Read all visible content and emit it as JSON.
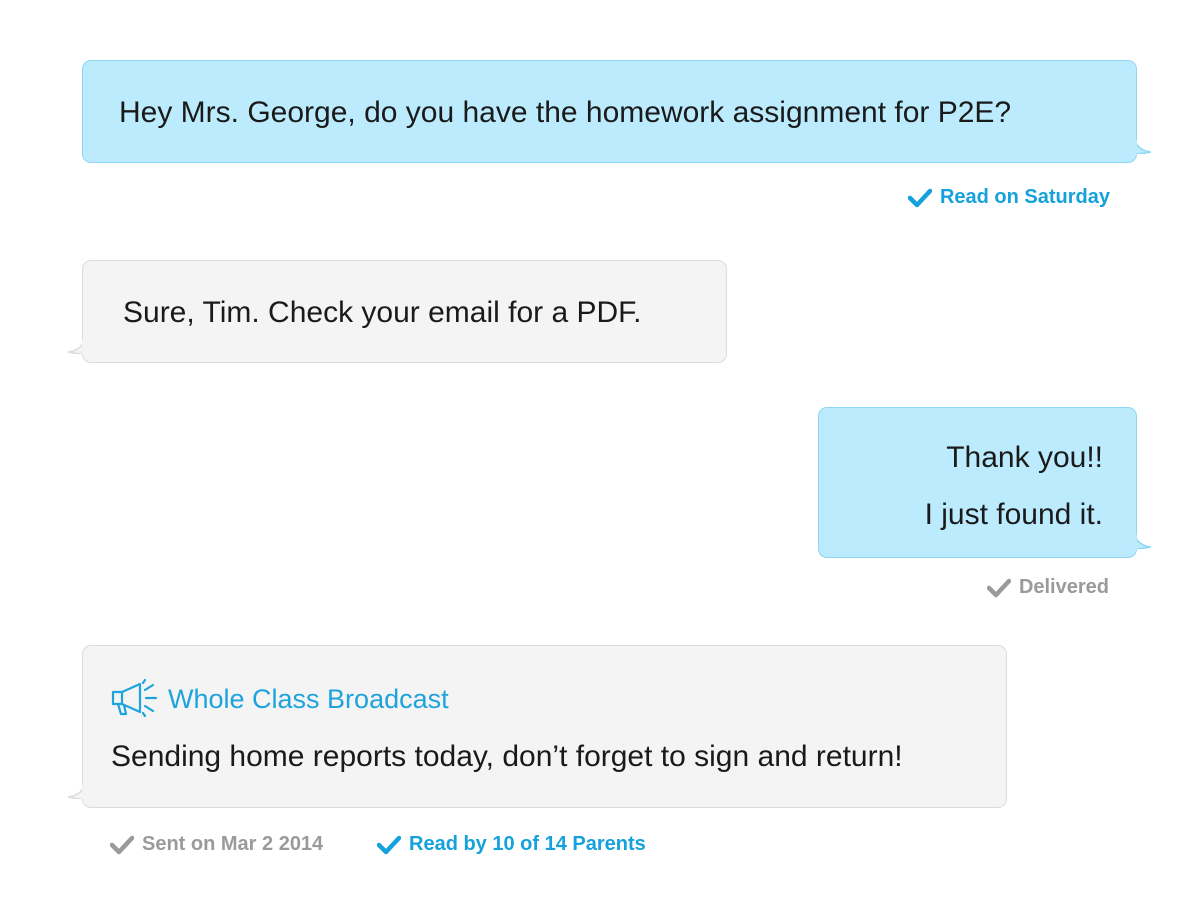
{
  "colors": {
    "outgoing_bubble": "#bbebfd",
    "incoming_bubble": "#f4f4f4",
    "accent_blue": "#15a2dc",
    "status_gray": "#9a9a9a"
  },
  "messages": [
    {
      "direction": "outgoing",
      "text": "Hey Mrs. George, do you have the homework assignment for P2E?",
      "status": {
        "icon": "checkmark-icon",
        "label": "Read on Saturday",
        "color": "blue"
      }
    },
    {
      "direction": "incoming",
      "text": "Sure, Tim. Check your email for a PDF."
    },
    {
      "direction": "outgoing",
      "lines": [
        "Thank you!!",
        "I just found it."
      ],
      "status": {
        "icon": "checkmark-icon",
        "label": "Delivered",
        "color": "gray"
      }
    },
    {
      "direction": "incoming",
      "type": "broadcast",
      "header_icon": "megaphone-icon",
      "header": "Whole Class Broadcast",
      "text": "Sending home reports today, don’t forget to sign and return!",
      "statuses": [
        {
          "icon": "checkmark-icon",
          "label": "Sent on Mar 2 2014",
          "color": "gray"
        },
        {
          "icon": "checkmark-icon",
          "label": "Read by 10 of 14 Parents",
          "color": "blue"
        }
      ]
    }
  ]
}
